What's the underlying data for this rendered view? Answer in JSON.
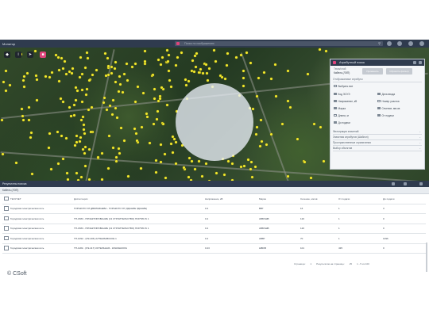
{
  "app": {
    "title": "Монитор",
    "search_placeholder": "Поиск по изображению"
  },
  "map": {
    "dot_color": "#f2ea2e",
    "controls": [
      "layers-icon",
      "info-icon",
      "cursor-icon",
      "brand-icon"
    ]
  },
  "attribute_panel": {
    "title": "Атрибутный поиск",
    "layer_label": "Тема/слой",
    "layer_value": "Кабель (ЛЭП)",
    "apply_button": "Применить",
    "reset_button": "Сбросить фильтр",
    "section_label": "Отображаемые атрибуты",
    "select_all": "Выбрать все",
    "checkboxes": [
      {
        "label": "Код ЭСУЭ",
        "checked": true
      },
      {
        "label": "Дата ввода",
        "checked": true
      },
      {
        "label": "Напряжение, кВ",
        "checked": true
      },
      {
        "label": "Номер участка",
        "checked": false
      },
      {
        "label": "Марка",
        "checked": true
      },
      {
        "label": "Сечение, мм кв",
        "checked": true
      },
      {
        "label": "Длина, м",
        "checked": false
      },
      {
        "label": "От подачи",
        "checked": true
      },
      {
        "label": "До подачи",
        "checked": true
      }
    ],
    "accordions": [
      "Фильтрация значений",
      "Значения атрибутов (Шаблон)",
      "Пространственные ограничения",
      "Выбор объектов"
    ]
  },
  "results": {
    "title": "Результаты поиска",
    "tab": "Кабель (ЛЭП)",
    "columns": [
      "ТЕХУЧЕТ",
      "Диспетчерск",
      "Напряжение, кВ",
      "Марка",
      "Сечение, мм кв",
      "От подачи",
      "До подачи"
    ],
    "rows": [
      [
        "Городская электрическая сеть",
        "ГОРЬКОГО УЛ ДВИЛЬЯНЕВА - ГОРЬКОГО УЛ (ЗДАНИЕ ЗДАНИЕ)",
        "0.4",
        "ВВГ",
        "16",
        "1",
        "3"
      ],
      [
        "Городская электрическая сеть",
        "ТП-1583 - ПРОЕКТИРОВАНИЕ (13 СТРОИТЕЛЬСТВО) ПОРТИК Б 1",
        "0.4",
        "АВБбШВ",
        "120",
        "1",
        "0"
      ],
      [
        "Городская электрическая сеть",
        "ТП-1583 - ПРОЕКТИРОВАНИЕ (13 СТРОИТЕЛЬСТВО) ПОРТИК Б 1",
        "0.4",
        "АВБбШВ",
        "120",
        "1",
        "0"
      ],
      [
        "Городская электрическая сеть",
        "ТП-1092 - (ЛЭ-406) АЛТЕНБАВСКОЕ 1",
        "0.4",
        "АВВГ",
        "70",
        "1",
        "1396"
      ],
      [
        "Городская электрическая сеть",
        "ТП-1182 - (ЛЭ-417) КОТЕЛЬНАЯ - КИНОШКОЛА",
        "0.23",
        "ШВОВ",
        "101",
        "435",
        "0"
      ]
    ],
    "pager": {
      "label": "Страница:",
      "page": "1",
      "per_page_label": "Результатов на странице:",
      "per_page": "25",
      "range": "1 - 5 из 100"
    }
  },
  "footer": {
    "copyright": "© CSoft"
  }
}
